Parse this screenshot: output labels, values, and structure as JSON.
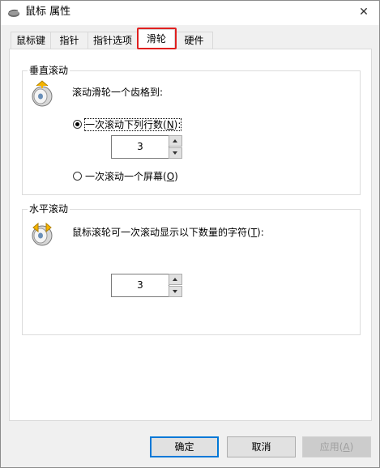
{
  "window": {
    "title": "鼠标 属性",
    "close_glyph": "✕"
  },
  "tabs": [
    {
      "label": "鼠标键"
    },
    {
      "label": "指针"
    },
    {
      "label": "指针选项"
    },
    {
      "label": "滑轮",
      "active": true
    },
    {
      "label": "硬件"
    }
  ],
  "vertical_scroll": {
    "title": "垂直滚动",
    "prompt": "滚动滑轮一个齿格到:",
    "option_lines_prefix": "一次滚动下列行数(",
    "option_lines_key": "N",
    "option_lines_suffix": "):",
    "lines_value": "3",
    "option_screen_prefix": "一次滚动一个屏幕(",
    "option_screen_key": "O",
    "option_screen_suffix": ")"
  },
  "horizontal_scroll": {
    "title": "水平滚动",
    "prompt_prefix": "鼠标滚轮可一次滚动显示以下数量的字符(",
    "prompt_key": "T",
    "prompt_suffix": "):",
    "chars_value": "3"
  },
  "buttons": {
    "ok": "确定",
    "cancel": "取消",
    "apply_prefix": "应用(",
    "apply_key": "A",
    "apply_suffix": ")"
  },
  "colors": {
    "highlight": "#e0201f",
    "default_button_border": "#0078d7",
    "dialog_bg": "#f0f0f0"
  }
}
